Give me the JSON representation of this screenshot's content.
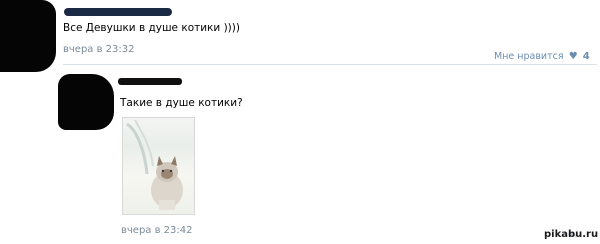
{
  "comments": [
    {
      "text": "Все Девушки в душе котики ))))",
      "time": "вчера в 23:32",
      "like_label": "Мне нравится",
      "like_count": "4"
    },
    {
      "text": "Такие в душе котики?",
      "time": "вчера в 23:42"
    }
  ],
  "watermark": "pikabu.ru",
  "icons": {
    "heart": "heart-icon",
    "reply": "reply-icon"
  }
}
